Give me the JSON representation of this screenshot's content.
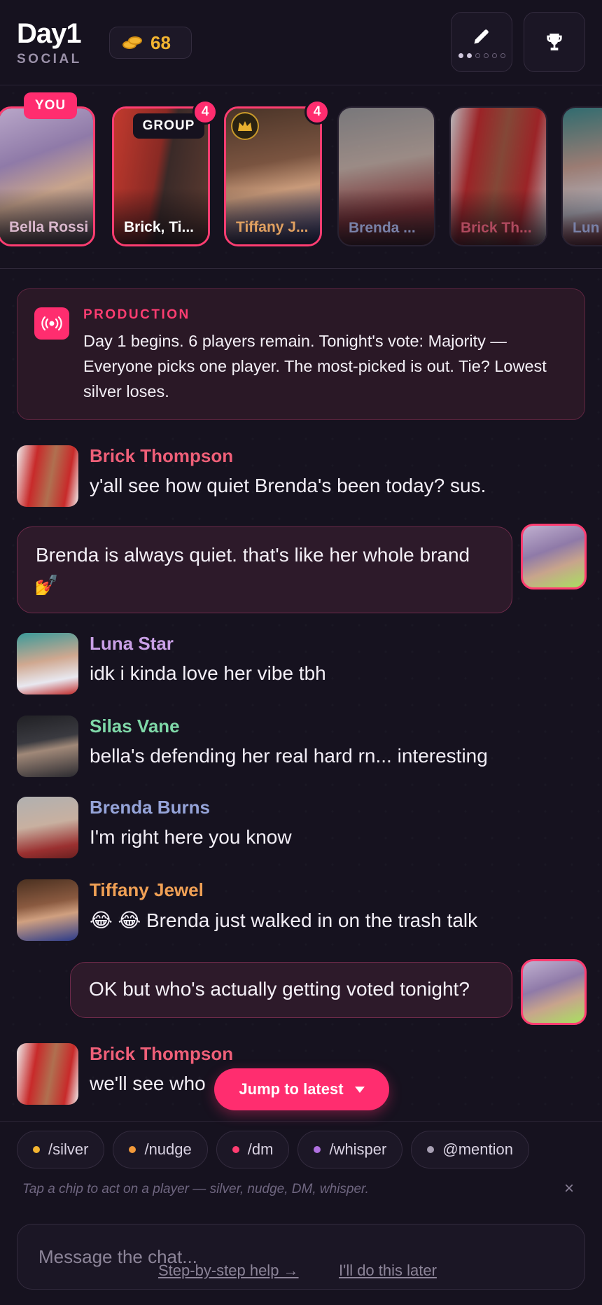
{
  "header": {
    "day": "Day1",
    "mode": "SOCIAL",
    "coins": "68"
  },
  "players": [
    {
      "name": "Bella Rossi",
      "tag": "YOU",
      "color": "#d9b7cc"
    },
    {
      "name": "Brick, Ti...",
      "tag": "GROUP",
      "badge": "4",
      "color": "#ffffff"
    },
    {
      "name": "Tiffany J...",
      "badge": "4",
      "color": "#e0a060"
    },
    {
      "name": "Brenda ...",
      "color": "#9aa6d6"
    },
    {
      "name": "Brick Th...",
      "color": "#e25c73"
    },
    {
      "name": "Lun",
      "color": "#9aa6d6"
    }
  ],
  "production": {
    "label": "PRODUCTION",
    "text": "Day 1 begins. 6 players remain. Tonight's vote: Majority — Everyone picks one player. The most-picked is out. Tie? Lowest silver loses."
  },
  "messages": [
    {
      "who": "Brick Thompson",
      "text": "y'all see how quiet Brenda's been today? sus.",
      "color": "#ef5f78"
    },
    {
      "me": true,
      "text_line1": "Brenda is always quiet. that's like her whole brand",
      "text_line2": "💅"
    },
    {
      "who": "Luna Star",
      "text": "idk i kinda love her vibe tbh",
      "color": "#c9a0e6"
    },
    {
      "who": "Silas Vane",
      "text": "bella's defending her real hard rn... interesting",
      "color": "#7fd8a8"
    },
    {
      "who": "Brenda Burns",
      "text": "I'm right here you know",
      "color": "#95a3d8"
    },
    {
      "who": "Tiffany Jewel",
      "text": "😂 😂  Brenda just walked in on the trash talk",
      "color": "#f0a055"
    },
    {
      "me": true,
      "text": "OK but who's actually getting voted tonight?"
    },
    {
      "who": "Brick Thompson",
      "text": "we'll see who",
      "color": "#ef5f78"
    }
  ],
  "jump_label": "Jump to latest",
  "chips": [
    {
      "label": "/silver",
      "dot": "#f3b531"
    },
    {
      "label": "/nudge",
      "dot": "#f39a3a"
    },
    {
      "label": "/dm",
      "dot": "#ff3d71"
    },
    {
      "label": "/whisper",
      "dot": "#b070e0"
    },
    {
      "label": "@mention",
      "dot": "#a8a0b4"
    }
  ],
  "hint": "Tap a chip to act on a player — silver, nudge, DM, whisper.",
  "hint_close": "×",
  "composer_placeholder": "Message the chat...",
  "help_link": "Step-by-step help →",
  "later_link": "I'll do this later"
}
